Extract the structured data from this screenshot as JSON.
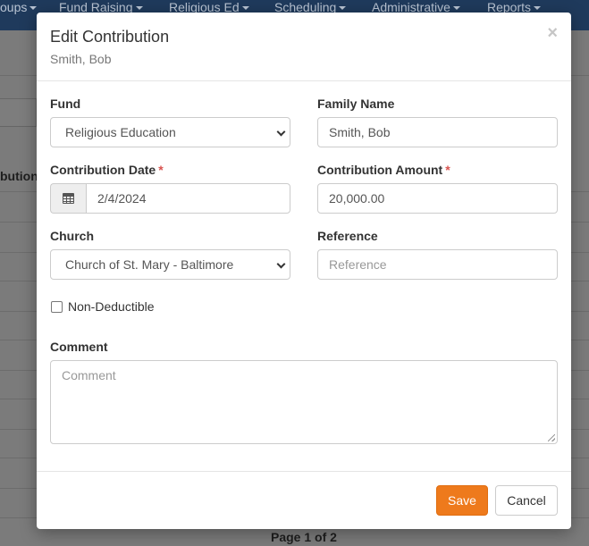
{
  "navbar": {
    "items": [
      {
        "label": "oups"
      },
      {
        "label": "Fund Raising"
      },
      {
        "label": "Religious Ed"
      },
      {
        "label": "Scheduling"
      },
      {
        "label": "Administrative"
      },
      {
        "label": "Reports"
      }
    ]
  },
  "background": {
    "column_header": "bution",
    "pager": "Page 1 of 2"
  },
  "modal": {
    "title": "Edit Contribution",
    "subtitle": "Smith, Bob",
    "close_glyph": "×",
    "fund": {
      "label": "Fund",
      "value": "Religious Education"
    },
    "family_name": {
      "label": "Family Name",
      "value": "Smith, Bob"
    },
    "contribution_date": {
      "label": "Contribution Date",
      "required_mark": "*",
      "value": "2/4/2024"
    },
    "contribution_amount": {
      "label": "Contribution Amount",
      "required_mark": "*",
      "value": "20,000.00"
    },
    "church": {
      "label": "Church",
      "value": "Church of St. Mary - Baltimore"
    },
    "reference": {
      "label": "Reference",
      "placeholder": "Reference",
      "value": ""
    },
    "non_deductible": {
      "label": "Non-Deductible",
      "checked": false
    },
    "comment": {
      "label": "Comment",
      "placeholder": "Comment",
      "value": ""
    },
    "buttons": {
      "save": "Save",
      "cancel": "Cancel"
    }
  },
  "colors": {
    "navbar": "#1f3a5c",
    "primary_button": "#ee7a1c",
    "required": "#d9534f",
    "overlay": "#7a7a7a"
  },
  "icons": {
    "date_addon": "calendar-icon",
    "close": "close-icon",
    "select": "chevron-down-icon"
  }
}
